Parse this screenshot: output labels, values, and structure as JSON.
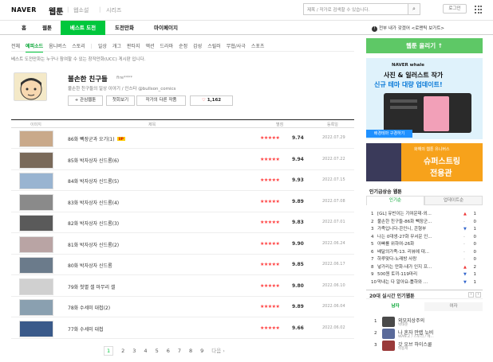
{
  "header": {
    "logo": "NAVER",
    "service": "웹툰",
    "links": [
      "웹소설",
      "시리즈"
    ],
    "search_placeholder": "제목 / 작가로 검색할 수 있습니다.",
    "login": "로그인"
  },
  "main_tabs": [
    "홈",
    "웹툰",
    "베스트 도전",
    "도전만화",
    "마이페이지"
  ],
  "notice": "전부 내가 갖겠어 <로맨틱 보가트>",
  "sub_tabs": [
    "전체",
    "에피소드",
    "옴니버스",
    "스토리",
    "|",
    "일상",
    "개그",
    "판타지",
    "액션",
    "드라마",
    "순정",
    "감성",
    "스릴러",
    "무협/사극",
    "스포츠"
  ],
  "description": "베스트 도전만화는 누구나 참여할 수 있는 창작만화(UCC) 게시판 입니다.",
  "comic": {
    "title": "불손한 친구들",
    "author": "fire****",
    "subtitle": "불손한 친구들의 일상 이야기 / 인스타 @bullson_comics",
    "buttons": [
      "+ 관심웹툰",
      "첫회보기",
      "작가의 다른 작품"
    ],
    "likes": "1,162"
  },
  "table": {
    "headers": [
      "이미지",
      "제목",
      "별점",
      "등록일"
    ],
    "rows": [
      {
        "title": "86화 빽장군과 오기(1)",
        "badge": "UP",
        "score": "9.74",
        "date": "2022.07.29"
      },
      {
        "title": "85화 박자상자 신드롬(6)",
        "badge": "",
        "score": "9.94",
        "date": "2022.07.22"
      },
      {
        "title": "84화 박자상자 신드롬(5)",
        "badge": "",
        "score": "9.93",
        "date": "2022.07.15"
      },
      {
        "title": "83화 박자상자 신드롬(4)",
        "badge": "",
        "score": "9.89",
        "date": "2022.07.08"
      },
      {
        "title": "82화 박자상자 신드롬(3)",
        "badge": "",
        "score": "9.83",
        "date": "2022.07.01"
      },
      {
        "title": "81화 박자상자 신드롬(2)",
        "badge": "",
        "score": "9.90",
        "date": "2022.06.24"
      },
      {
        "title": "80화 박자상자 신드롬",
        "badge": "",
        "score": "9.85",
        "date": "2022.06.17"
      },
      {
        "title": "79화 첫별 셀 마무리 셀",
        "badge": "",
        "score": "9.80",
        "date": "2022.06.10"
      },
      {
        "title": "78화 수세미 대첩(2)",
        "badge": "",
        "score": "9.89",
        "date": "2022.06.04"
      },
      {
        "title": "77화 수세미 대첩",
        "badge": "",
        "score": "9.66",
        "date": "2022.06.02"
      }
    ]
  },
  "stars": "★★★★★",
  "pagination": {
    "pages": [
      "1",
      "2",
      "3",
      "4",
      "5",
      "6",
      "7",
      "8",
      "9"
    ],
    "next": "다음 ›"
  },
  "sidebar": {
    "upload": "웹툰 올리기 ↑",
    "ad1": {
      "brand": "NAVER whale",
      "line1": "사진 & 일러스트 작가",
      "line2": "신규 테마 대량 업데이트!",
      "tag": "배경테마 구경하기"
    },
    "ad2": {
      "brand": "화해의 웹툰 유니버스",
      "line1": "슈퍼스트링",
      "line2": "전용관"
    },
    "ranking_title": "인기급상승 웹툰",
    "ranking_tabs": [
      "인기순",
      "업데이트순"
    ],
    "ranking": [
      {
        "n": "1",
        "t": "[GL] 유빈이는 기여운데-외...",
        "arrow": "▲",
        "c": "1"
      },
      {
        "n": "2",
        "t": "불손한 친구들-86화 빽장군...",
        "arrow": "-",
        "c": "0"
      },
      {
        "n": "3",
        "t": "가족입니다-콘인니, 콘형부",
        "arrow": "▼",
        "c": "1"
      },
      {
        "n": "4",
        "t": "나는 0대생-27화 무서운 인...",
        "arrow": "-",
        "c": "0"
      },
      {
        "n": "5",
        "t": "아빠를 위하여-26화",
        "arrow": "-",
        "c": "0"
      },
      {
        "n": "6",
        "t": "배달의가족-13. 리뷰에 대...",
        "arrow": "-",
        "c": "0"
      },
      {
        "n": "7",
        "t": "하루맞다-노래방 사랑",
        "arrow": "-",
        "c": "0"
      },
      {
        "n": "8",
        "t": "넣가리는 만화-내가 인지 프...",
        "arrow": "▲",
        "c": "2"
      },
      {
        "n": "9",
        "t": "500원 토끼-119마리",
        "arrow": "▼",
        "c": "1"
      },
      {
        "n": "10",
        "t": "막내는 다 알아요-틀하와 ...",
        "arrow": "▼",
        "c": "1"
      }
    ],
    "realtime_title": "20대 실시간 인기웹툰",
    "gender_tabs": [
      "남자",
      "여자"
    ],
    "realtime": [
      {
        "n": "1",
        "t": "외모지상주의",
        "s": "박태준"
      },
      {
        "n": "2",
        "t": "나 혼자 만렙 뉴비",
        "s": "WAN.Z / 스토리 / 메..."
      },
      {
        "n": "3",
        "t": "갓 오브 하이스쿨",
        "s": "박용제"
      }
    ]
  },
  "colors": {
    "brand_green": "#00c73c",
    "star_red": "#ff3c3c",
    "upload_green": "#5ec866"
  }
}
